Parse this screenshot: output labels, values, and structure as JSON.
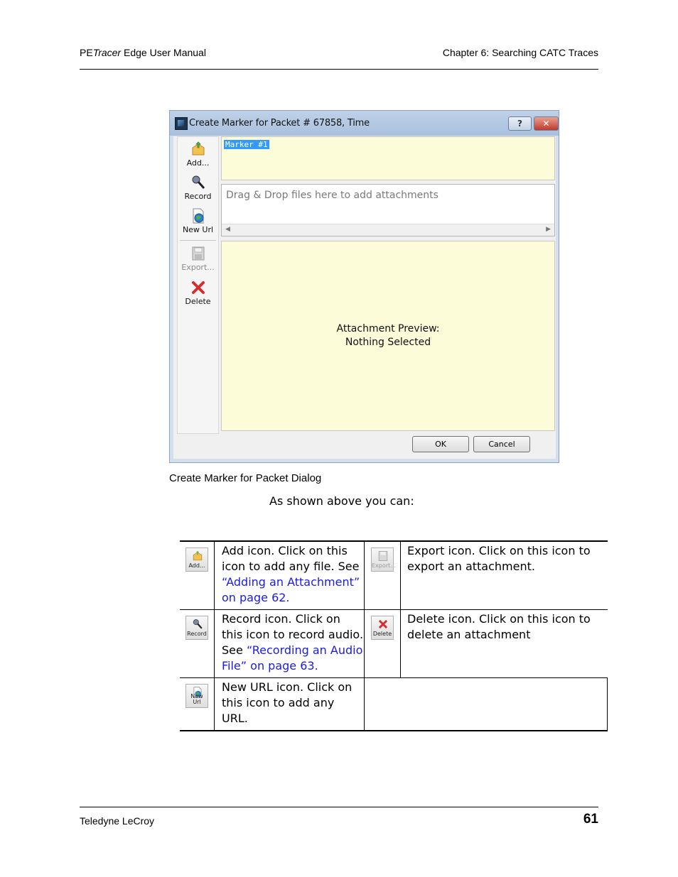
{
  "header": {
    "product_bold": "PE",
    "product_italic": "Tracer",
    "manual_title": " Edge User Manual",
    "chapter": "Chapter 6: Searching CATC Traces"
  },
  "dialog": {
    "title": "Create Marker for Packet # 67858, Time",
    "help_label": "?",
    "close_label": "✕",
    "toolbar": {
      "add": "Add...",
      "record": "Record",
      "new_url": "New Url",
      "export": "Export...",
      "delete": "Delete"
    },
    "marker_text": "Marker #1",
    "drop_placeholder": "Drag & Drop files here to add attachments",
    "preview_line1": "Attachment Preview:",
    "preview_line2": "Nothing Selected",
    "ok": "OK",
    "cancel": "Cancel"
  },
  "caption": "Create Marker for Packet Dialog",
  "intro": "As shown above you can:",
  "table": {
    "add": {
      "icon_label": "Add...",
      "text": "Add icon. Click on this icon to add any file. See ",
      "link": "“Adding an Attachment” on page 62."
    },
    "export": {
      "icon_label": "Export...",
      "text": "Export icon. Click on this icon to export an attachment."
    },
    "record": {
      "icon_label": "Record",
      "text": "Record icon. Click on this icon to record audio. See ",
      "link": "“Recording an Audio File” on page 63."
    },
    "delete": {
      "icon_label": "Delete",
      "text": "Delete icon. Click on this icon to delete an attachment"
    },
    "new_url": {
      "icon_label": "New Url",
      "text": "New URL icon. Click on this icon to add any URL."
    }
  },
  "footer": {
    "company": "Teledyne LeCroy",
    "page_number": "61"
  }
}
